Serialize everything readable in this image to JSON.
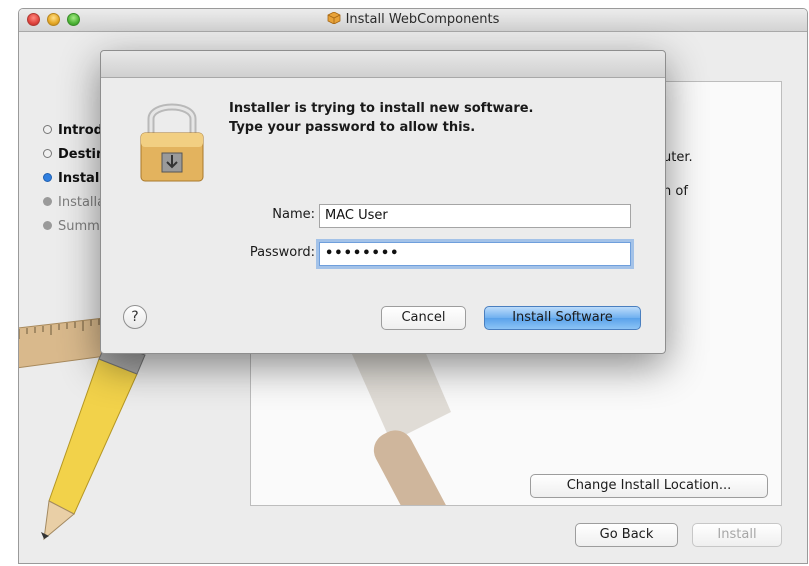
{
  "window": {
    "title": "Install WebComponents"
  },
  "sidebar": {
    "steps": [
      {
        "label": "Introduction",
        "state": "done"
      },
      {
        "label": "Destination Select",
        "state": "done"
      },
      {
        "label": "Installation Type",
        "state": "current"
      },
      {
        "label": "Installation",
        "state": "future"
      },
      {
        "label": "Summary",
        "state": "future"
      }
    ]
  },
  "panel": {
    "text_line1": "uter.",
    "text_line2": "n of"
  },
  "buttons": {
    "change_location": "Change Install Location...",
    "go_back": "Go Back",
    "install": "Install"
  },
  "auth_dialog": {
    "prompt_line1": "Installer is trying to install new software.",
    "prompt_line2": "Type your password to allow this.",
    "name_label": "Name:",
    "name_value": "MAC User",
    "password_label": "Password:",
    "password_value": "••••••••",
    "help_label": "?",
    "cancel_label": "Cancel",
    "confirm_label": "Install Software"
  },
  "colors": {
    "accent": "#5aa2ea",
    "current_step": "#2f7fe0"
  },
  "icons": [
    "package-icon",
    "lock-icon",
    "help-icon",
    "pencil-icon",
    "ruler-icon",
    "brush-icon"
  ]
}
